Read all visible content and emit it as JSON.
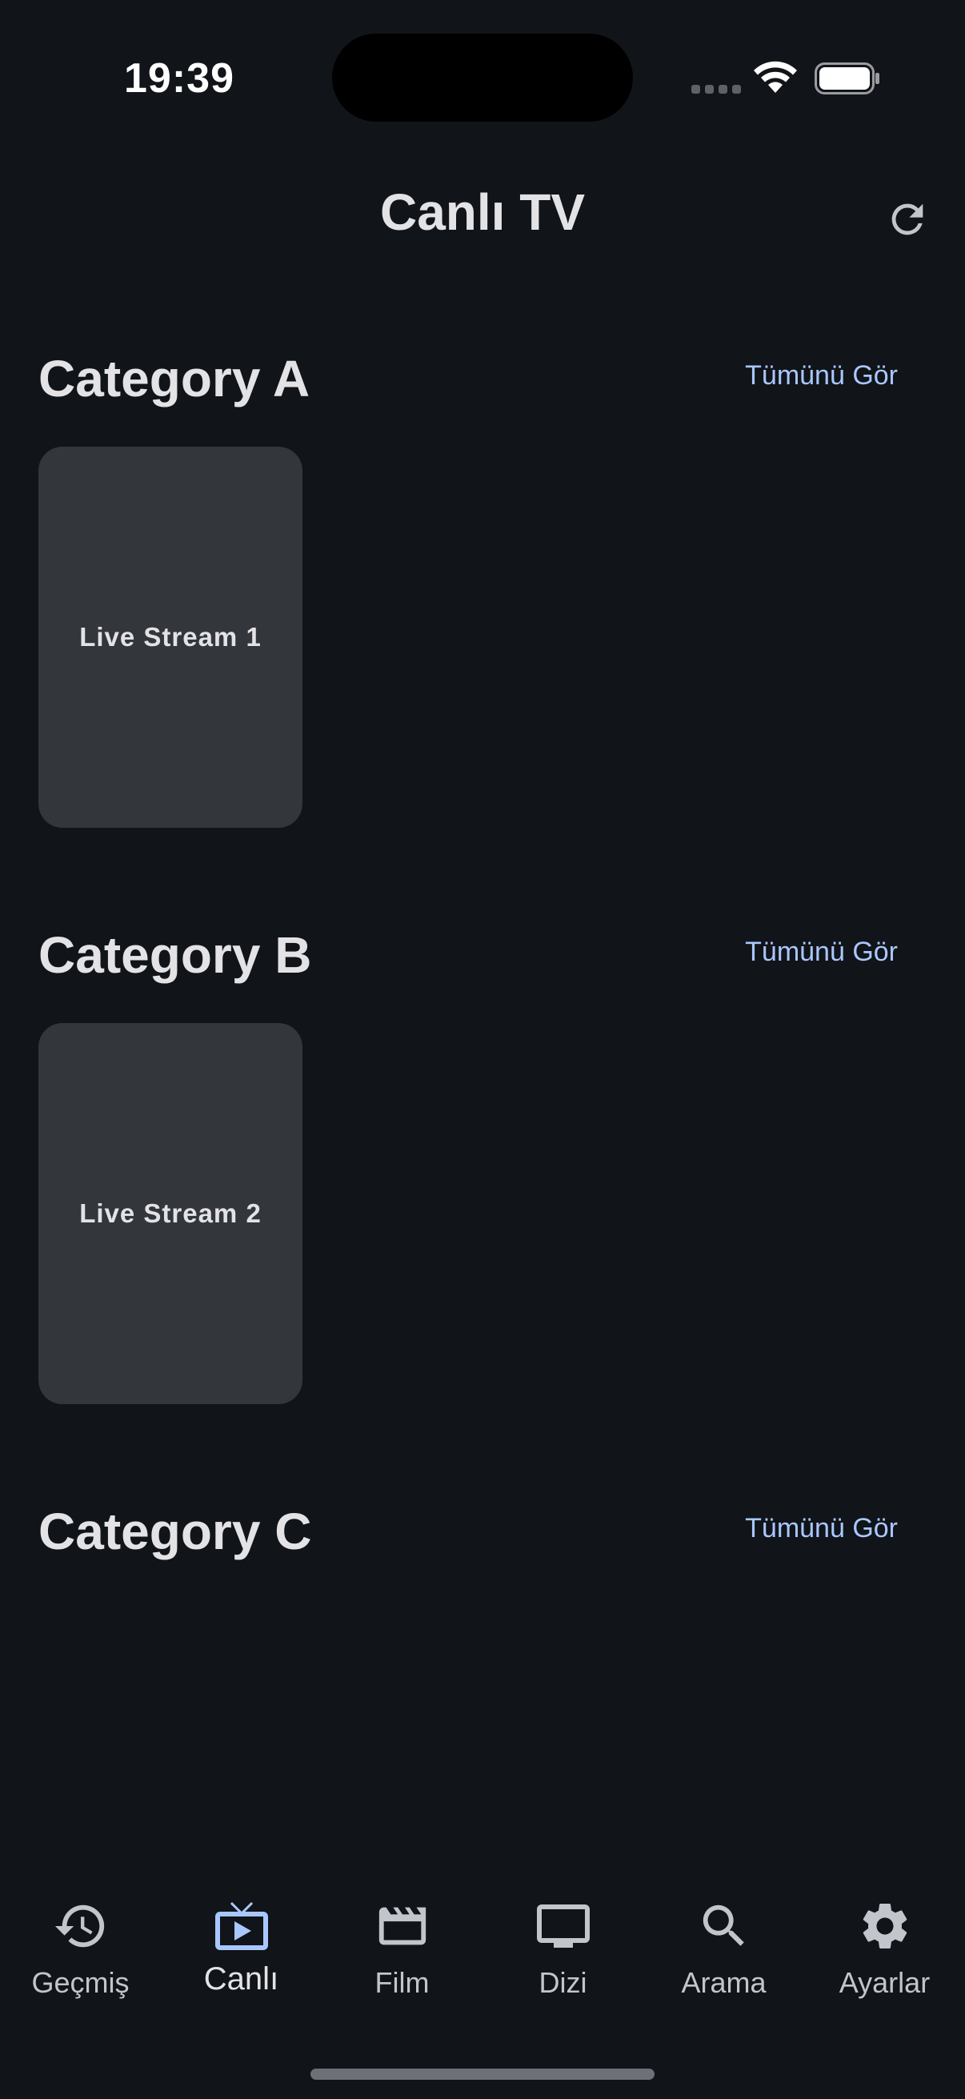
{
  "status_bar": {
    "time": "19:39"
  },
  "header": {
    "title": "Canlı TV",
    "refresh_icon": "refresh-icon"
  },
  "sections": [
    {
      "title": "Category A",
      "see_all": "Tümünü Gör",
      "cards": [
        {
          "label": "Live Stream 1"
        }
      ]
    },
    {
      "title": "Category B",
      "see_all": "Tümünü Gör",
      "cards": [
        {
          "label": "Live Stream 2"
        }
      ]
    },
    {
      "title": "Category C",
      "see_all": "Tümünü Gör",
      "cards": []
    }
  ],
  "bottom_nav": {
    "active_index": 1,
    "items": [
      {
        "label": "Geçmiş",
        "icon": "history-icon"
      },
      {
        "label": "Canlı",
        "icon": "live-tv-icon"
      },
      {
        "label": "Film",
        "icon": "movie-clapper-icon"
      },
      {
        "label": "Dizi",
        "icon": "tv-monitor-icon"
      },
      {
        "label": "Arama",
        "icon": "search-icon"
      },
      {
        "label": "Ayarlar",
        "icon": "gear-icon"
      }
    ]
  },
  "colors": {
    "background": "#111418",
    "card": "#33363b",
    "accent_link": "#a9c7ff",
    "active_nav_icon": "#a9c7ff",
    "inactive_nav_icon": "#c3c5cc",
    "text_primary": "#e3e3e6"
  }
}
